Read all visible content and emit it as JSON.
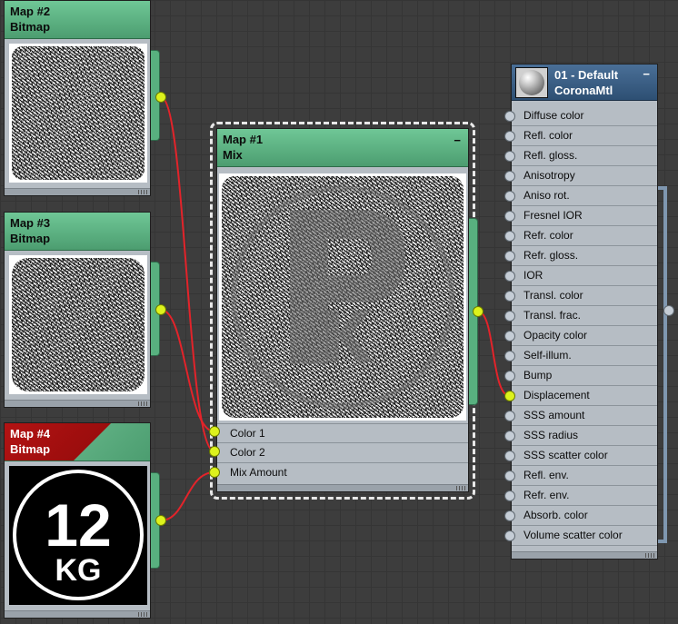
{
  "nodes": {
    "map2": {
      "title": "Map #2",
      "type": "Bitmap"
    },
    "map3": {
      "title": "Map #3",
      "type": "Bitmap"
    },
    "map4": {
      "title": "Map #4",
      "type": "Bitmap",
      "badge_number": "12",
      "badge_unit": "KG"
    },
    "map1": {
      "title": "Map #1",
      "type": "Mix",
      "collapse_glyph": "−",
      "inputs": [
        "Color 1",
        "Color 2",
        "Mix Amount"
      ]
    },
    "material": {
      "title": "01 - Default",
      "type": "CoronaMtl",
      "collapse_glyph": "−",
      "preview_icon": "material-sphere-icon",
      "slots": [
        "Diffuse color",
        "Refl. color",
        "Refl. gloss.",
        "Anisotropy",
        "Aniso rot.",
        "Fresnel IOR",
        "Refr. color",
        "Refr. gloss.",
        "IOR",
        "Transl. color",
        "Transl. frac.",
        "Opacity color",
        "Self-illum.",
        "Bump",
        "Displacement",
        "SSS amount",
        "SSS radius",
        "SSS scatter color",
        "Refl. env.",
        "Refr. env.",
        "Absorb. color",
        "Volume scatter color"
      ],
      "connected_slot": "Displacement"
    }
  },
  "colors": {
    "canvas": "#3d3d3d",
    "wire": "#e3232a",
    "socket_connected": "#ddf21c",
    "node_header_green": "#5cad80",
    "node_header_blue": "#3a5e85",
    "node_header_red": "#b31313"
  }
}
